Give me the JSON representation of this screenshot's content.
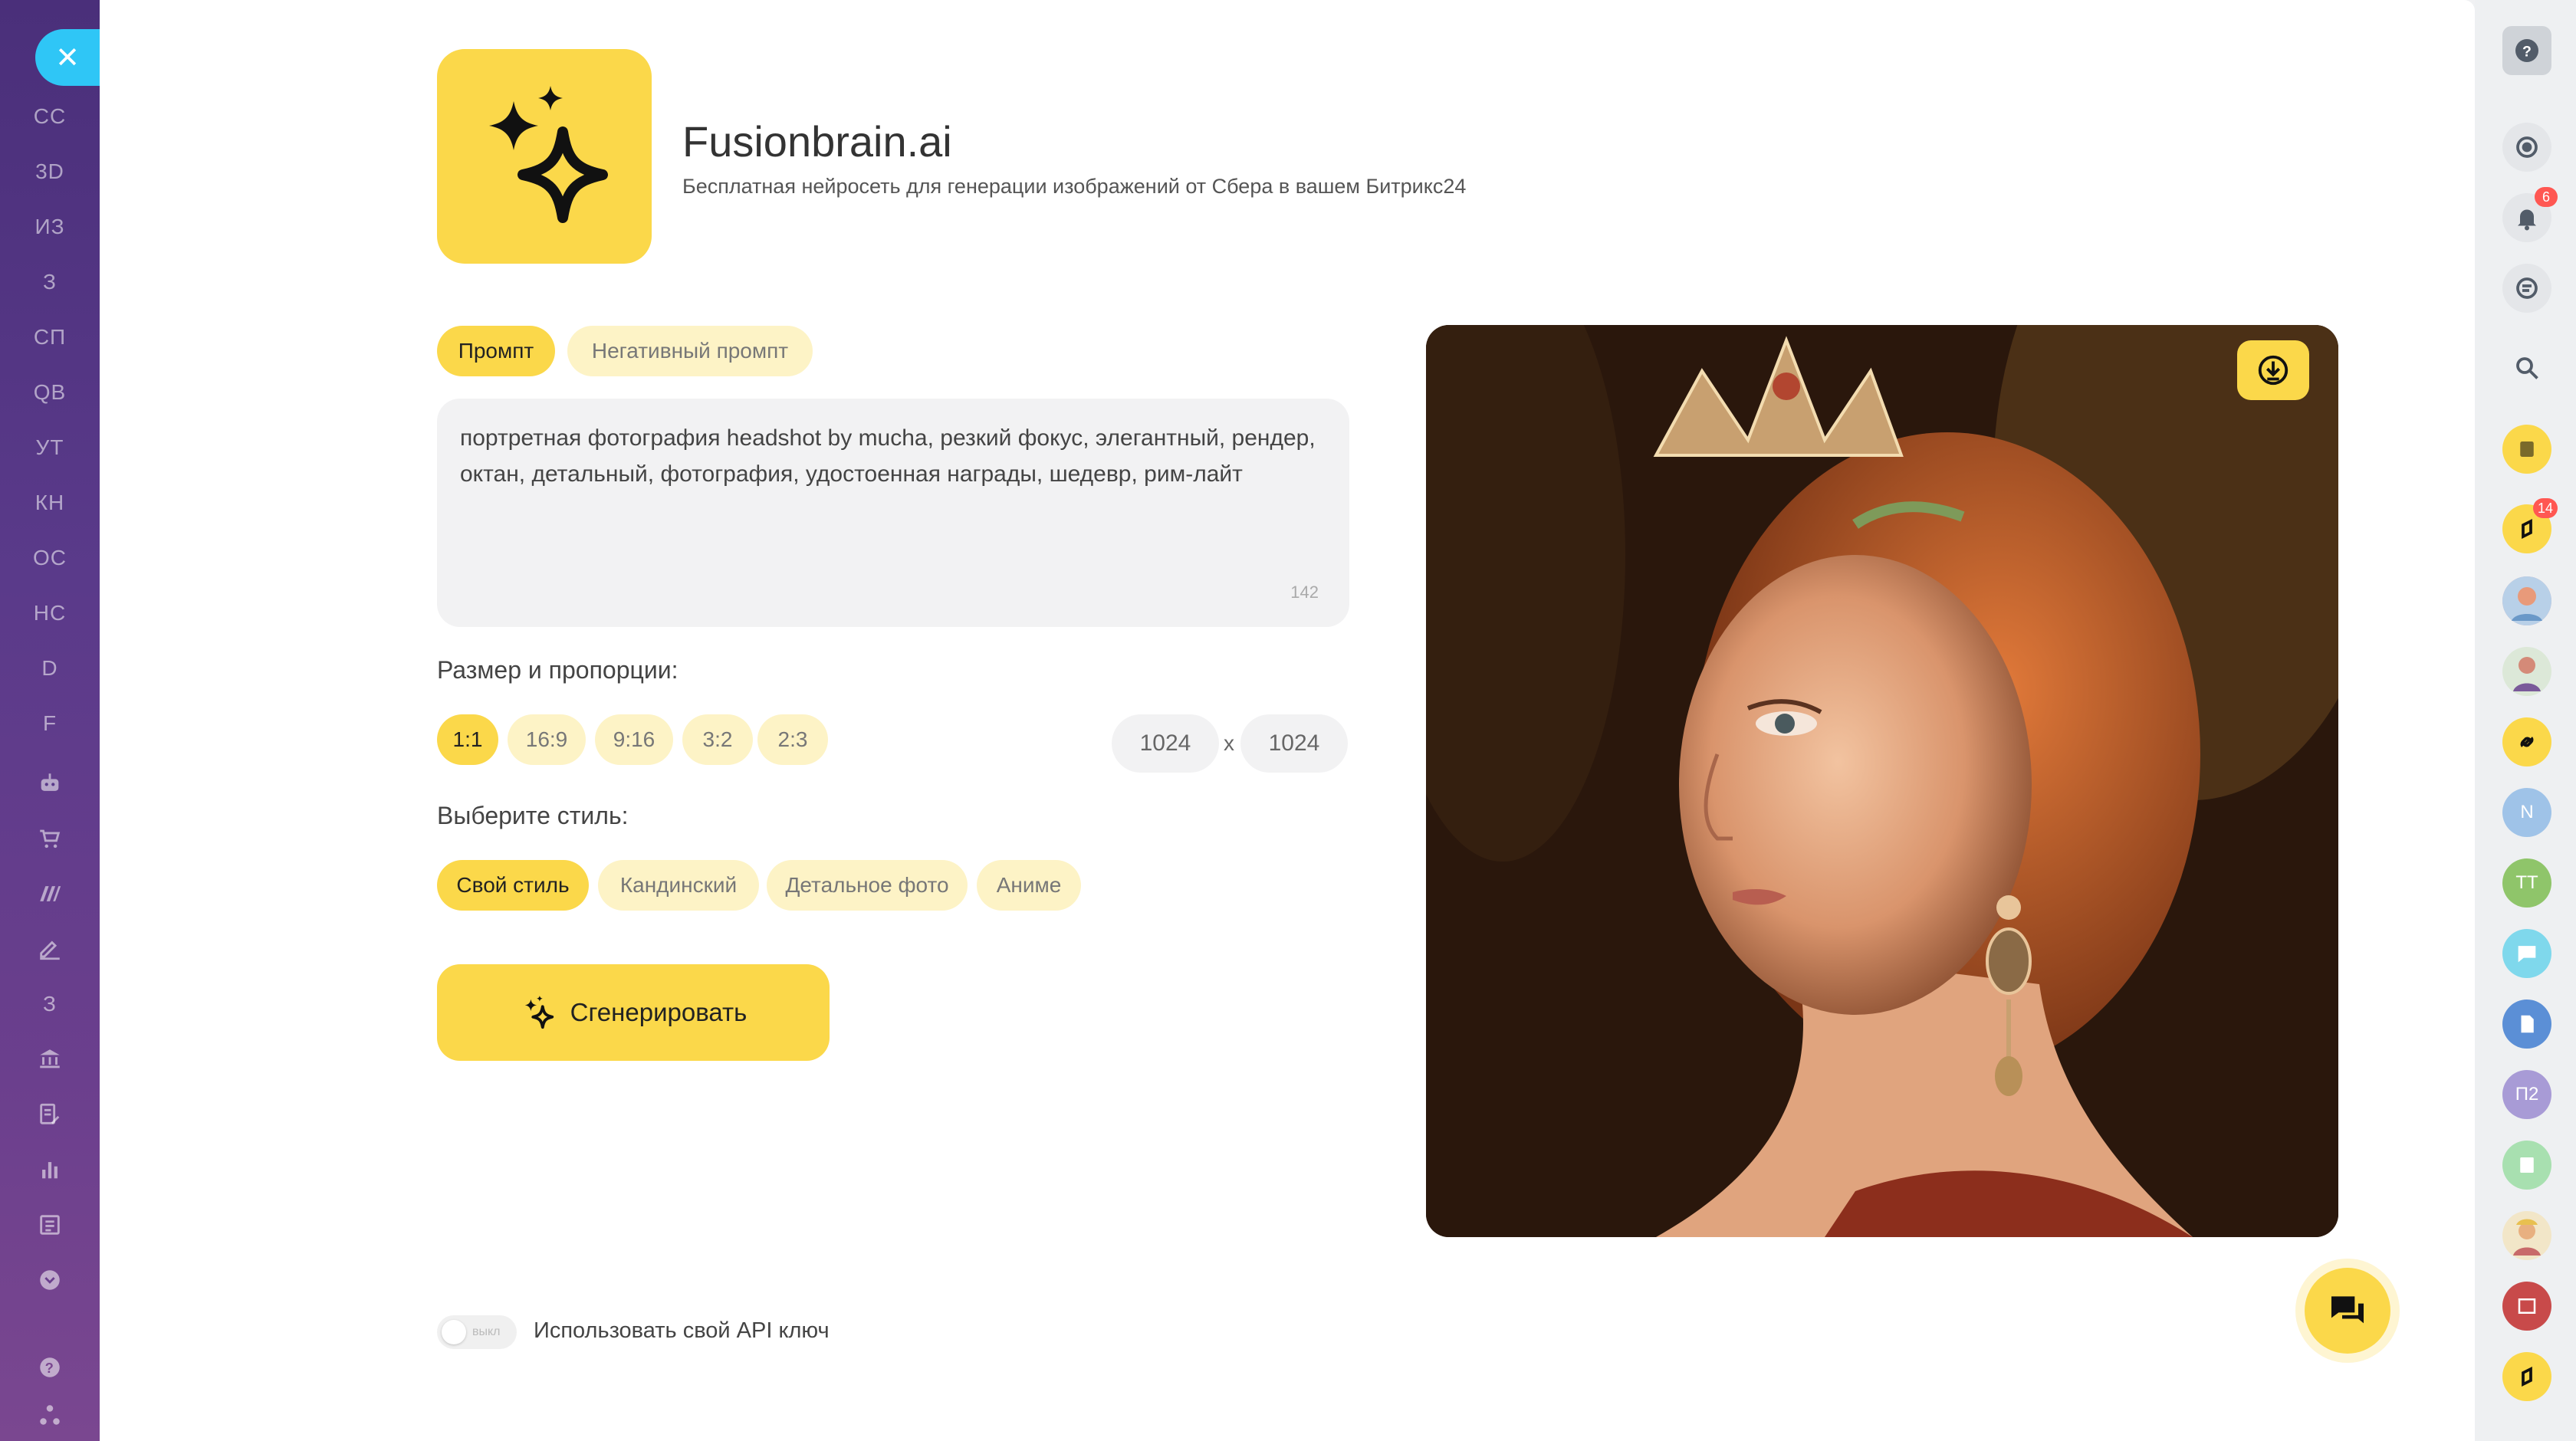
{
  "left_sidebar": {
    "close_icon": "close-icon",
    "items": [
      {
        "label": "СС"
      },
      {
        "label": "3D"
      },
      {
        "label": "ИЗ"
      },
      {
        "label": "З"
      },
      {
        "label": "СП"
      },
      {
        "label": "QB"
      },
      {
        "label": "УТ"
      },
      {
        "label": "КН"
      },
      {
        "label": "ОС"
      },
      {
        "label": "НС"
      },
      {
        "label": "D"
      },
      {
        "label": "F"
      }
    ],
    "icons": [
      {
        "name": "robot-icon"
      },
      {
        "name": "cart-icon"
      },
      {
        "name": "brand-mark-icon"
      },
      {
        "name": "signature-icon"
      },
      {
        "label": "З"
      },
      {
        "name": "bank-icon"
      },
      {
        "name": "document-edit-icon"
      },
      {
        "name": "bar-chart-icon"
      },
      {
        "name": "checklist-icon"
      },
      {
        "name": "chevron-down-icon"
      },
      {
        "name": "help-icon"
      },
      {
        "name": "structure-icon"
      }
    ]
  },
  "app": {
    "title": "Fusionbrain.ai",
    "subtitle": "Бесплатная нейросеть для генерации изображений от Сбера в вашем Битрикс24",
    "logo_icon": "sparkle-icon",
    "accent_color": "#fbd84a"
  },
  "tabs": [
    {
      "label": "Промпт",
      "active": true
    },
    {
      "label": "Негативный промпт",
      "active": false
    }
  ],
  "prompt": {
    "text": "портретная фотография headshot by mucha, резкий фокус, элегантный, рендер, октан, детальный, фотография, удостоенная награды, шедевр, рим-лайт",
    "char_count": "142"
  },
  "size": {
    "label": "Размер и пропорции:",
    "options": [
      "1:1",
      "16:9",
      "9:16",
      "3:2",
      "2:3"
    ],
    "selected": "1:1",
    "width": "1024",
    "height": "1024",
    "separator": "x"
  },
  "style": {
    "label": "Выберите стиль:",
    "options": [
      "Свой стиль",
      "Кандинский",
      "Детальное фото",
      "Аниме"
    ],
    "selected": "Свой стиль"
  },
  "generate_button": {
    "label": "Сгенерировать"
  },
  "api_toggle": {
    "state_label": "выкл",
    "label": "Использовать свой API ключ"
  },
  "right_sidebar": {
    "items": [
      {
        "name": "help-icon"
      },
      {
        "name": "refresh-icon"
      },
      {
        "name": "bell-icon",
        "badge": "6"
      },
      {
        "name": "chat-list-icon"
      },
      {
        "name": "search-icon"
      },
      {
        "name": "bookmark-icon"
      },
      {
        "name": "app-icon",
        "badge": "14"
      },
      {
        "name": "user-avatar"
      },
      {
        "name": "user-avatar"
      },
      {
        "name": "link-icon"
      },
      {
        "label": "N"
      },
      {
        "label": "ТТ"
      },
      {
        "name": "chat-bubble-icon"
      },
      {
        "name": "document-icon"
      },
      {
        "label": "П2"
      },
      {
        "name": "notes-icon"
      },
      {
        "name": "user-avatar"
      },
      {
        "name": "media-icon"
      },
      {
        "name": "app-icon"
      }
    ]
  }
}
